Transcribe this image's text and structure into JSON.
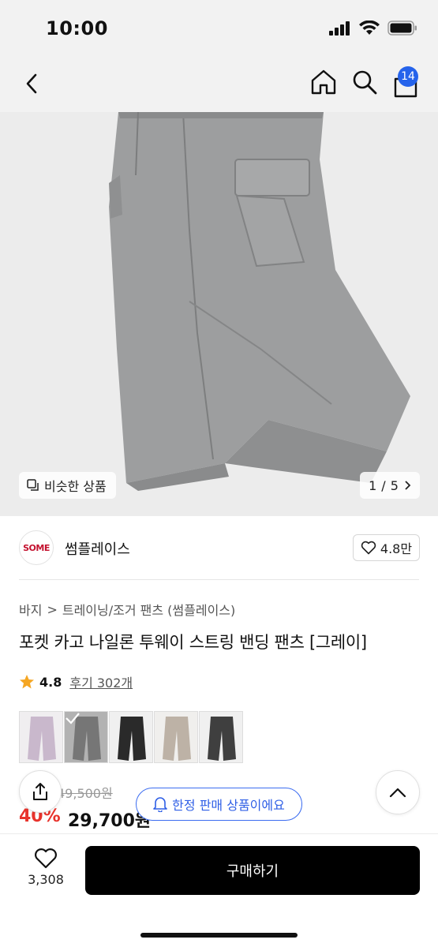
{
  "status_bar": {
    "time": "10:00"
  },
  "nav": {
    "cart_count": "14"
  },
  "product_image": {
    "similar_label": "비슷한 상품",
    "page_current": "1",
    "page_separator": "/",
    "page_total": "5"
  },
  "brand": {
    "logo_text": "SOME",
    "name": "썸플레이스",
    "likes": "4.8만"
  },
  "breadcrumb": {
    "category": "바지",
    "separator": ">",
    "subcategory": "트레이닝/조거 팬츠 (썸플레이스)"
  },
  "product": {
    "title": "포켓 카고 나일론 투웨이 스트링 밴딩 팬츠 [그레이]",
    "rating": "4.8",
    "reviews": "후기 302개",
    "original_price": "49,500원",
    "discount": "40%",
    "price": "29,700원"
  },
  "swatches": [
    {
      "name": "lavender",
      "color": "#c9b8cc",
      "selected": false
    },
    {
      "name": "gray",
      "color": "#8b8b8b",
      "selected": true
    },
    {
      "name": "black",
      "color": "#2a2a2a",
      "selected": false
    },
    {
      "name": "beige",
      "color": "#bdb2a6",
      "selected": false
    },
    {
      "name": "charcoal",
      "color": "#3f3f3f",
      "selected": false
    }
  ],
  "banner": {
    "text": "한정 판매 상품이에요"
  },
  "bottom": {
    "wish_count": "3,308",
    "buy_label": "구매하기"
  },
  "icons": {
    "back": "chevron-left-icon",
    "home": "home-icon",
    "search": "search-icon",
    "cart": "cart-icon",
    "share": "share-icon",
    "scroll_top": "chevron-up-icon",
    "heart": "heart-icon",
    "bell": "bell-icon",
    "star": "star-icon"
  },
  "colors": {
    "accent_blue": "#2563eb",
    "discount_red": "#e8332c",
    "star_gold": "#f5a623"
  }
}
